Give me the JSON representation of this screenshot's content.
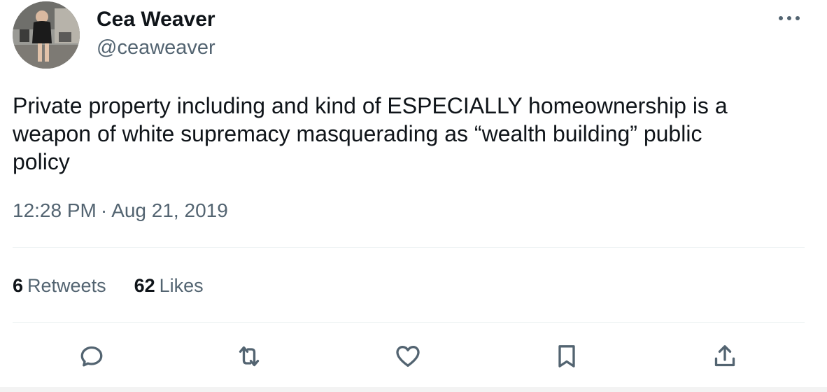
{
  "author": {
    "display_name": "Cea Weaver",
    "handle": "@ceaweaver",
    "avatar_icon": "profile-photo"
  },
  "tweet": {
    "text": "Private property including and kind of ESPECIALLY homeownership is a\nweapon of white supremacy masquerading as “wealth building” public\npolicy",
    "time": "12:28 PM",
    "separator": "·",
    "date": "Aug 21, 2019"
  },
  "stats": {
    "retweets_count": "6",
    "retweets_label": "Retweets",
    "likes_count": "62",
    "likes_label": "Likes"
  },
  "actions": {
    "reply_icon": "reply-icon",
    "retweet_icon": "retweet-icon",
    "like_icon": "heart-icon",
    "bookmark_icon": "bookmark-icon",
    "share_icon": "share-icon"
  },
  "colors": {
    "text_primary": "#0f1419",
    "text_secondary": "#536471",
    "divider": "#eff3f4"
  }
}
